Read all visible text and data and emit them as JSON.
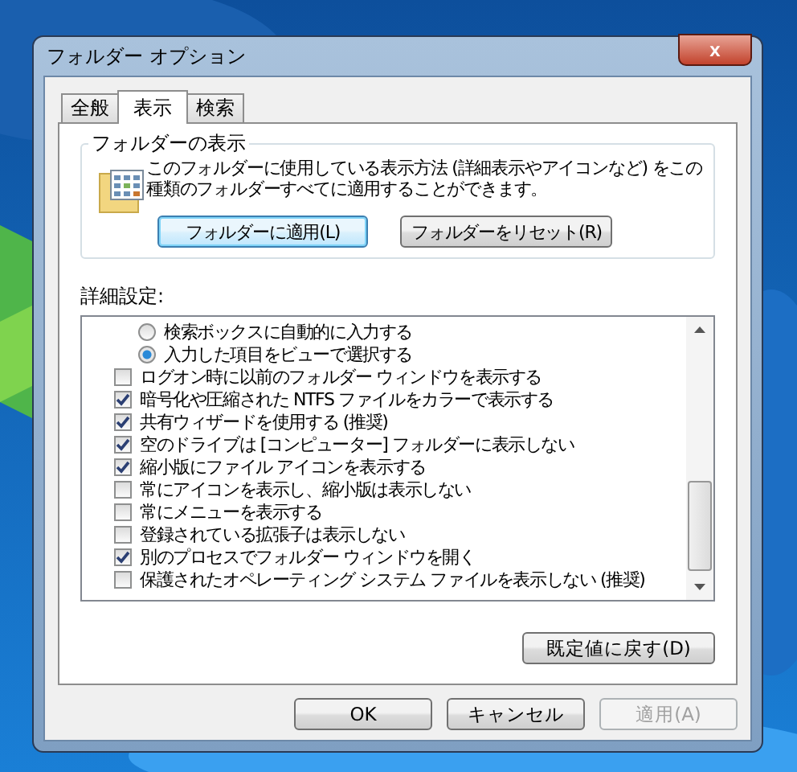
{
  "window": {
    "title": "フォルダー オプション",
    "close": "x"
  },
  "tabs": [
    {
      "label": "全般",
      "selected": false
    },
    {
      "label": "表示",
      "selected": true
    },
    {
      "label": "検索",
      "selected": false
    }
  ],
  "folder_views": {
    "title": "フォルダーの表示",
    "description": "このフォルダーに使用している表示方法 (詳細表示やアイコンなど) をこの種類のフォルダーすべてに適用することができます。",
    "buttons": [
      {
        "label": "フォルダーに適用(L)",
        "focused": true
      },
      {
        "label": "フォルダーをリセット(R)",
        "focused": false
      }
    ]
  },
  "advanced": {
    "label": "詳細設定:",
    "items": [
      {
        "kind": "radio",
        "label": "検索ボックスに自動的に入力する",
        "checked": false
      },
      {
        "kind": "radio",
        "label": "入力した項目をビューで選択する",
        "checked": true
      },
      {
        "kind": "checkbox",
        "label": "ログオン時に以前のフォルダー ウィンドウを表示する",
        "checked": false
      },
      {
        "kind": "checkbox",
        "label": "暗号化や圧縮された NTFS ファイルをカラーで表示する",
        "checked": true
      },
      {
        "kind": "checkbox",
        "label": "共有ウィザードを使用する (推奨)",
        "checked": true
      },
      {
        "kind": "checkbox",
        "label": "空のドライブは [コンピューター] フォルダーに表示しない",
        "checked": true
      },
      {
        "kind": "checkbox",
        "label": "縮小版にファイル アイコンを表示する",
        "checked": true
      },
      {
        "kind": "checkbox",
        "label": "常にアイコンを表示し、縮小版は表示しない",
        "checked": false
      },
      {
        "kind": "checkbox",
        "label": "常にメニューを表示する",
        "checked": false
      },
      {
        "kind": "checkbox",
        "label": "登録されている拡張子は表示しない",
        "checked": false
      },
      {
        "kind": "checkbox",
        "label": "別のプロセスでフォルダー ウィンドウを開く",
        "checked": true
      },
      {
        "kind": "checkbox",
        "label": "保護されたオペレーティング システム ファイルを表示しない (推奨)",
        "checked": false
      }
    ],
    "restore_button": "既定値に戻す(D)"
  },
  "buttons": [
    {
      "label": "OK",
      "disabled": false
    },
    {
      "label": "キャンセル",
      "disabled": false
    },
    {
      "label": "適用(A)",
      "disabled": true
    }
  ]
}
